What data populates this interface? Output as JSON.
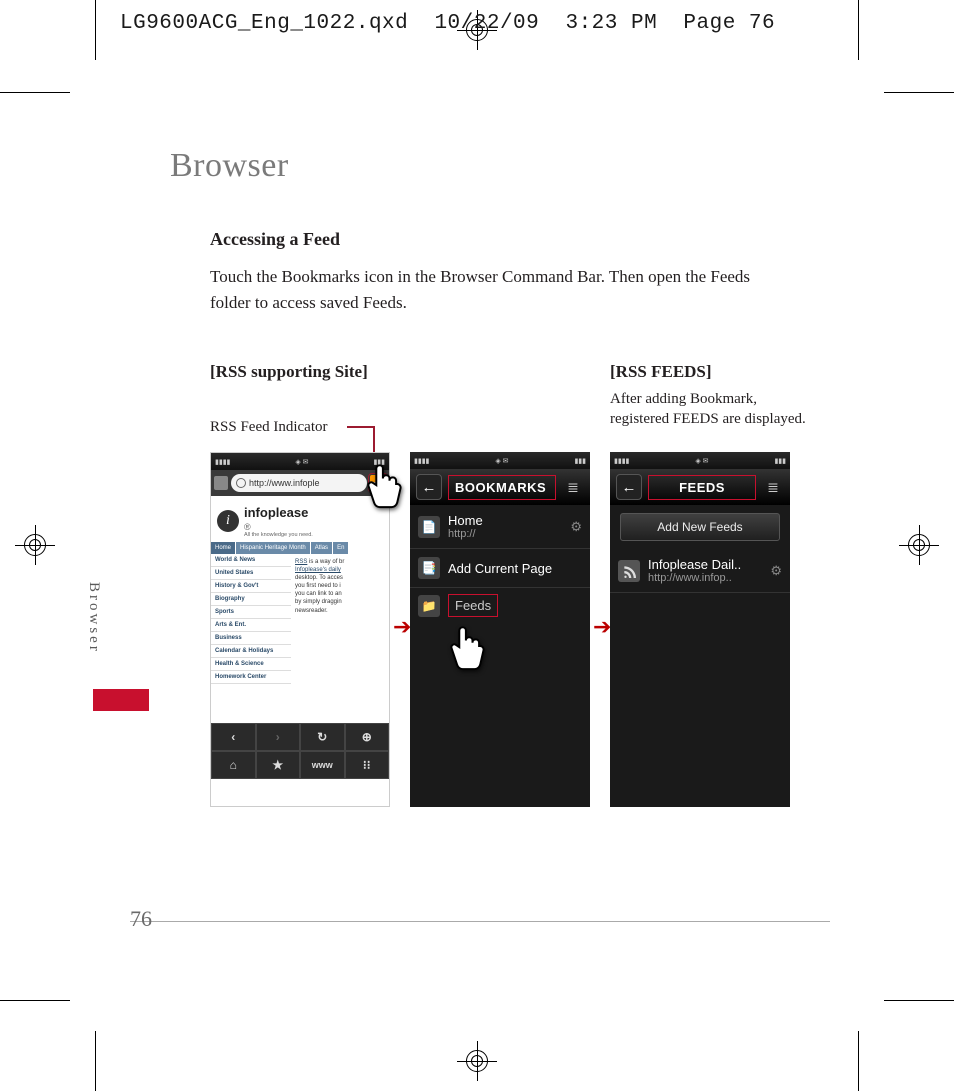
{
  "imposition_header": "LG9600ACG_Eng_1022.qxd  10/22/09  3:23 PM  Page 76",
  "page": {
    "title": "Browser",
    "section_title": "Accessing a Feed",
    "body": "Touch the Bookmarks icon in the Browser Command Bar. Then open the Feeds folder to access saved Feeds.",
    "side_tab": "Browser",
    "page_number": "76"
  },
  "figures": {
    "left": {
      "label": "[RSS supporting Site]",
      "caption": "RSS Feed Indicator"
    },
    "right": {
      "label": "[RSS FEEDS]",
      "caption": "After adding Bookmark, registered FEEDS are displayed."
    }
  },
  "phone1": {
    "url": "http://www.infople",
    "logo_name": "infoplease",
    "logo_tagline": "All the knowledge you need.",
    "tabs": [
      "Home",
      "Hispanic Heritage Month",
      "Atlas",
      "En"
    ],
    "nav": [
      "World & News",
      "United States",
      "History & Gov't",
      "Biography",
      "Sports",
      "Arts & Ent.",
      "Business",
      "Calendar & Holidays",
      "Health & Science",
      "Homework Center"
    ],
    "article_link": "RSS",
    "article_rest": " is a way of br",
    "article_lines": [
      "Infoplease's daily",
      "desktop. To acces",
      "you first need to i",
      "you can link to an",
      "by simply draggin",
      "newsreader."
    ],
    "bottombar": [
      "‹",
      "›",
      "↻",
      "⊕",
      "⌂",
      "★",
      "www",
      "⁝⁝"
    ]
  },
  "phone2": {
    "title": "BOOKMARKS",
    "items": [
      {
        "icon": "📄",
        "t1": "Home",
        "t2": "http://"
      },
      {
        "icon": "📑",
        "t1": "Add Current Page",
        "t2": ""
      },
      {
        "icon": "📁",
        "t1": "Feeds",
        "t2": ""
      }
    ],
    "feeds_label": "Feeds"
  },
  "phone3": {
    "title": "FEEDS",
    "add_button": "Add New Feeds",
    "item": {
      "t1": "Infoplease Dail..",
      "t2": "http://www.infop.."
    }
  }
}
